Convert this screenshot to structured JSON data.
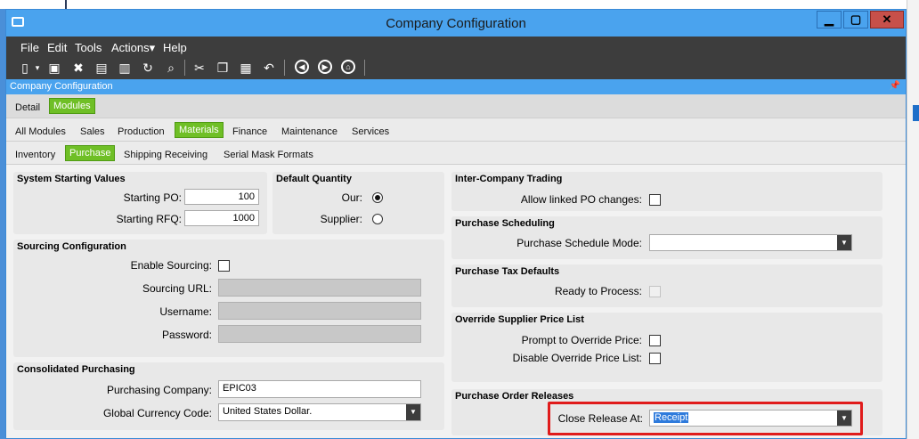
{
  "window": {
    "title": "Company Configuration",
    "min_label": "▁",
    "max_label": "▢",
    "close_label": "✕"
  },
  "menu": {
    "items": [
      "File",
      "Edit",
      "Tools",
      "Actions▾",
      "Help"
    ]
  },
  "toolbar": {
    "icons": [
      "new-icon",
      "save-icon",
      "delete-icon",
      "book-icon",
      "attach-icon",
      "refresh-icon",
      "clear-icon",
      "cut-icon",
      "copy-icon",
      "paste-icon",
      "undo-icon",
      "back-icon",
      "forward-icon",
      "home-icon"
    ]
  },
  "panel": {
    "caption": "Company Configuration"
  },
  "tabs": {
    "row1": [
      "Detail",
      "Modules"
    ],
    "row2": [
      "All Modules",
      "Sales",
      "Production",
      "Materials",
      "Finance",
      "Maintenance",
      "Services"
    ],
    "row3": [
      "Inventory",
      "Purchase",
      "Shipping Receiving",
      "Serial Mask Formats"
    ]
  },
  "system_starting_values": {
    "title": "System Starting Values",
    "starting_po_label": "Starting PO:",
    "starting_po_value": "100",
    "starting_rfq_label": "Starting RFQ:",
    "starting_rfq_value": "1000"
  },
  "default_quantity": {
    "title": "Default Quantity",
    "our_label": "Our:",
    "supplier_label": "Supplier:",
    "selected": "Our"
  },
  "sourcing": {
    "title": "Sourcing Configuration",
    "enable_label": "Enable Sourcing:",
    "url_label": "Sourcing URL:",
    "username_label": "Username:",
    "password_label": "Password:"
  },
  "consolidated": {
    "title": "Consolidated Purchasing",
    "company_label": "Purchasing Company:",
    "company_value": "EPIC03",
    "currency_label": "Global Currency Code:",
    "currency_value": "United States Dollar."
  },
  "intercompany": {
    "title": "Inter-Company Trading",
    "linked_label": "Allow linked PO changes:"
  },
  "scheduling": {
    "title": "Purchase Scheduling",
    "mode_label": "Purchase Schedule Mode:",
    "mode_value": ""
  },
  "tax": {
    "title": "Purchase Tax Defaults",
    "ready_label": "Ready to Process:"
  },
  "override": {
    "title": "Override Supplier Price List",
    "prompt_label": "Prompt to Override Price:",
    "disable_label": "Disable Override Price List:"
  },
  "releases": {
    "title": "Purchase Order Releases",
    "close_label": "Close Release At:",
    "close_value": "Receipt"
  },
  "colors": {
    "accent": "#4aa3ee",
    "active_tab": "#6fbf26",
    "menubar": "#3d3d3d",
    "highlight": "#e01b1b"
  }
}
